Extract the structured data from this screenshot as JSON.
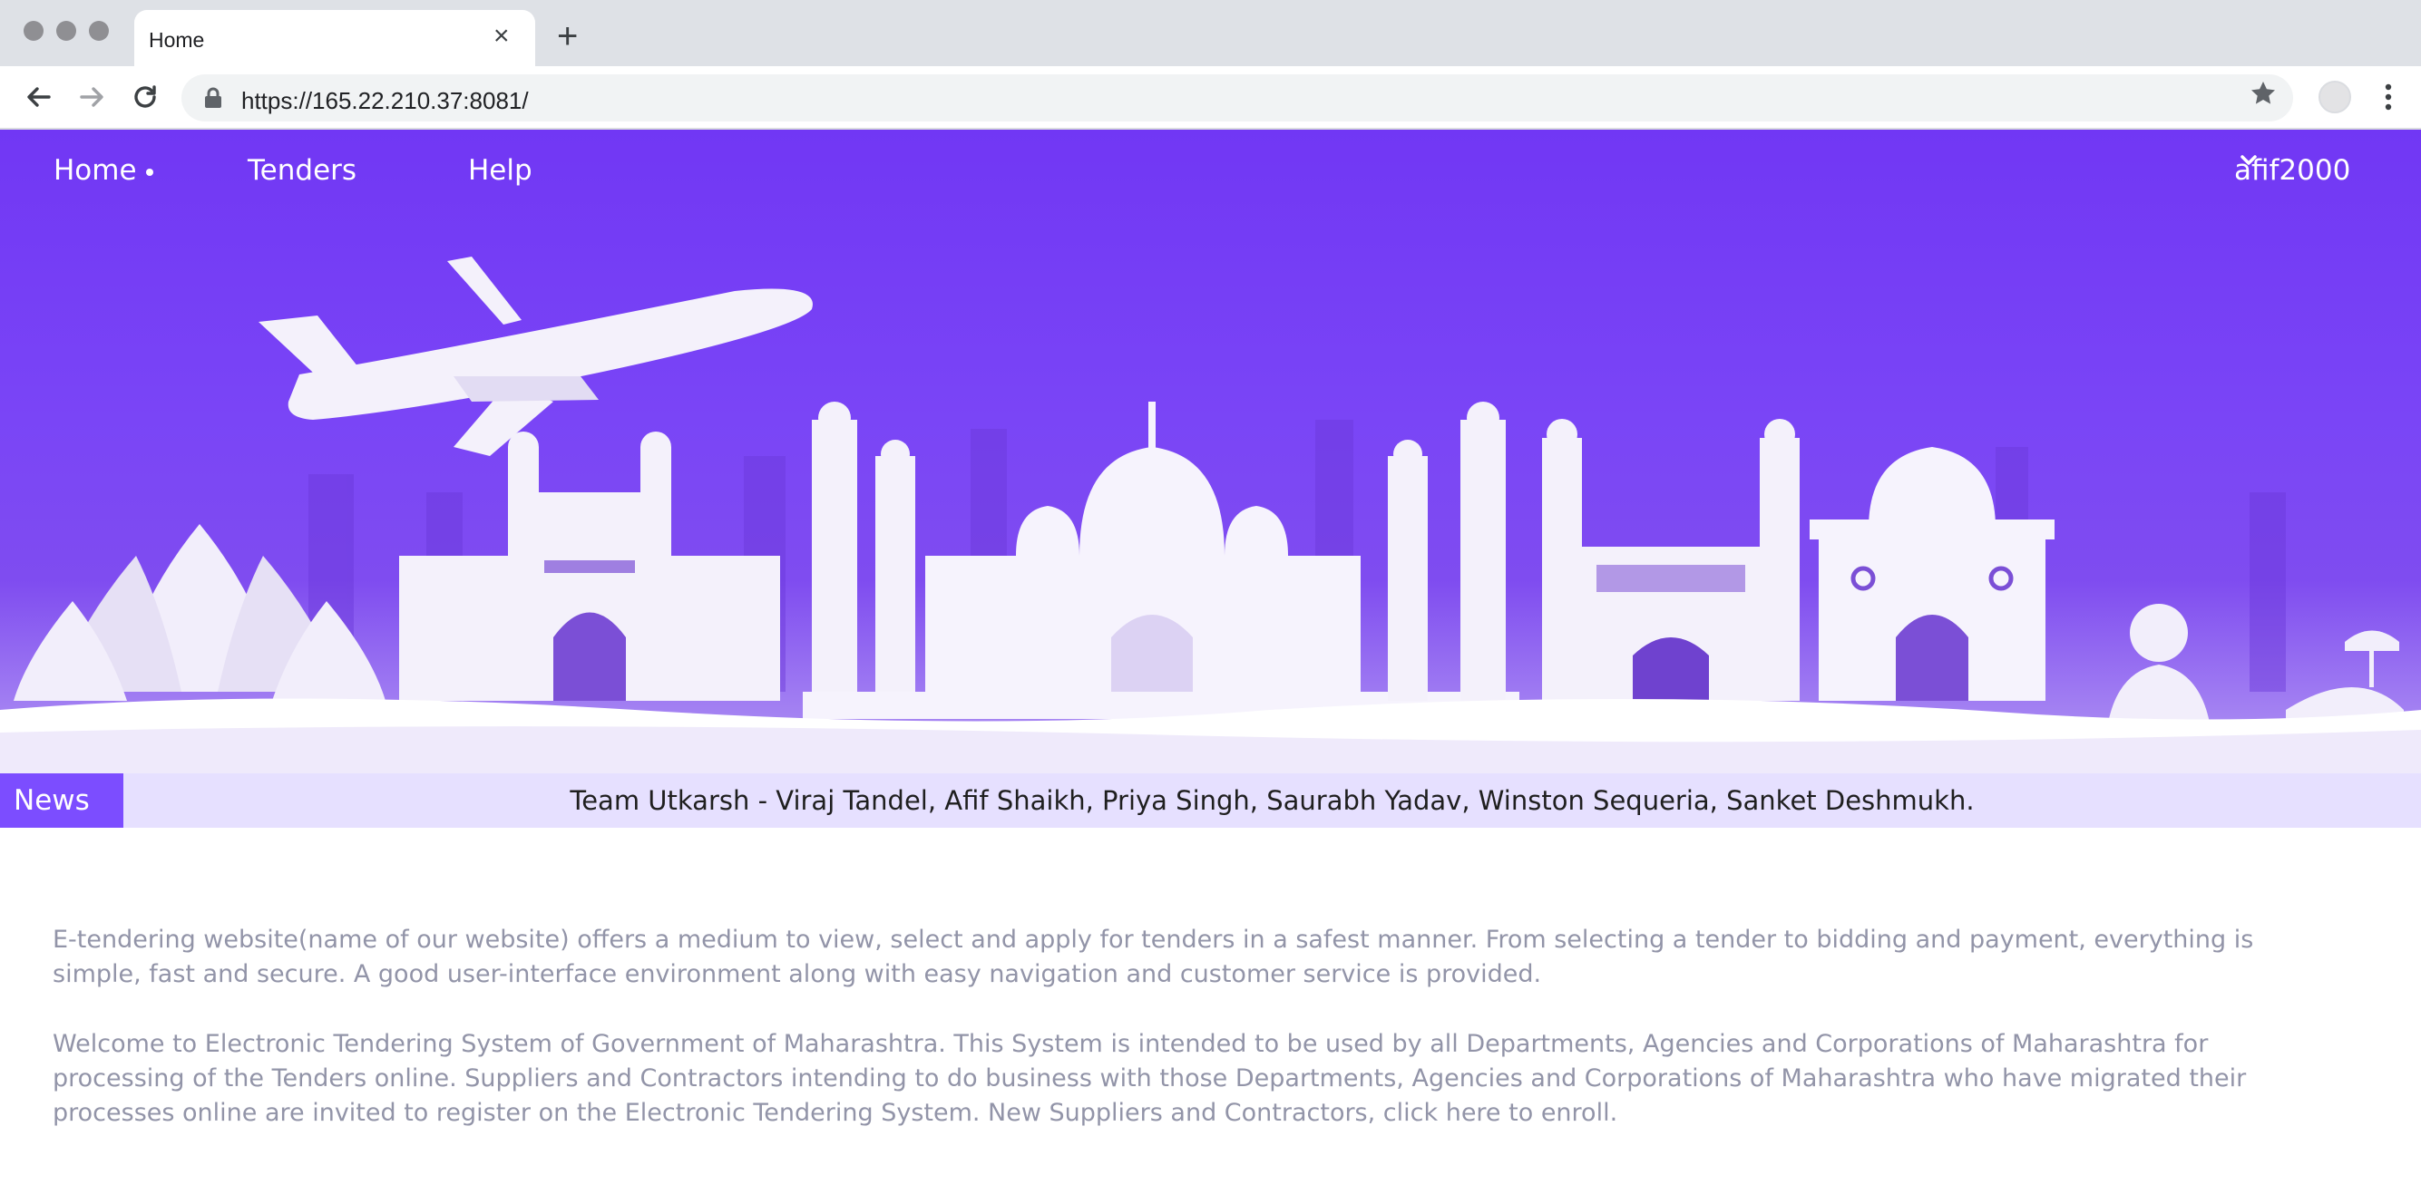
{
  "browser": {
    "tab_title": "Home",
    "url": "https://165.22.210.37:8081/"
  },
  "nav": {
    "home": "Home",
    "tenders": "Tenders",
    "help": "Help",
    "user": "afif2000"
  },
  "news": {
    "label": "News",
    "text": "Team Utkarsh - Viraj Tandel, Afif Shaikh, Priya Singh, Saurabh Yadav, Winston Sequeria, Sanket Deshmukh."
  },
  "content": {
    "paragraph1": "E-tendering website(name of our website) offers a medium to view, select and apply for tenders in a safest manner. From selecting a tender to bidding and payment, everything is simple, fast and secure. A good user-interface environment along with easy navigation and customer service is provided.",
    "paragraph2": "Welcome to Electronic Tendering System of Government of Maharashtra. This System is intended to be used by all Departments, Agencies and Corporations of Maharashtra for processing of the Tenders online. Suppliers and Contractors intending to do business with those Departments, Agencies and Corporations of Maharashtra who have migrated their processes online are invited to register on the Electronic Tendering System. New Suppliers and Contractors, click here to enroll."
  },
  "colors": {
    "accent": "#7c4dff",
    "news_bar": "#e6e0ff",
    "body_text": "#9294a8"
  }
}
